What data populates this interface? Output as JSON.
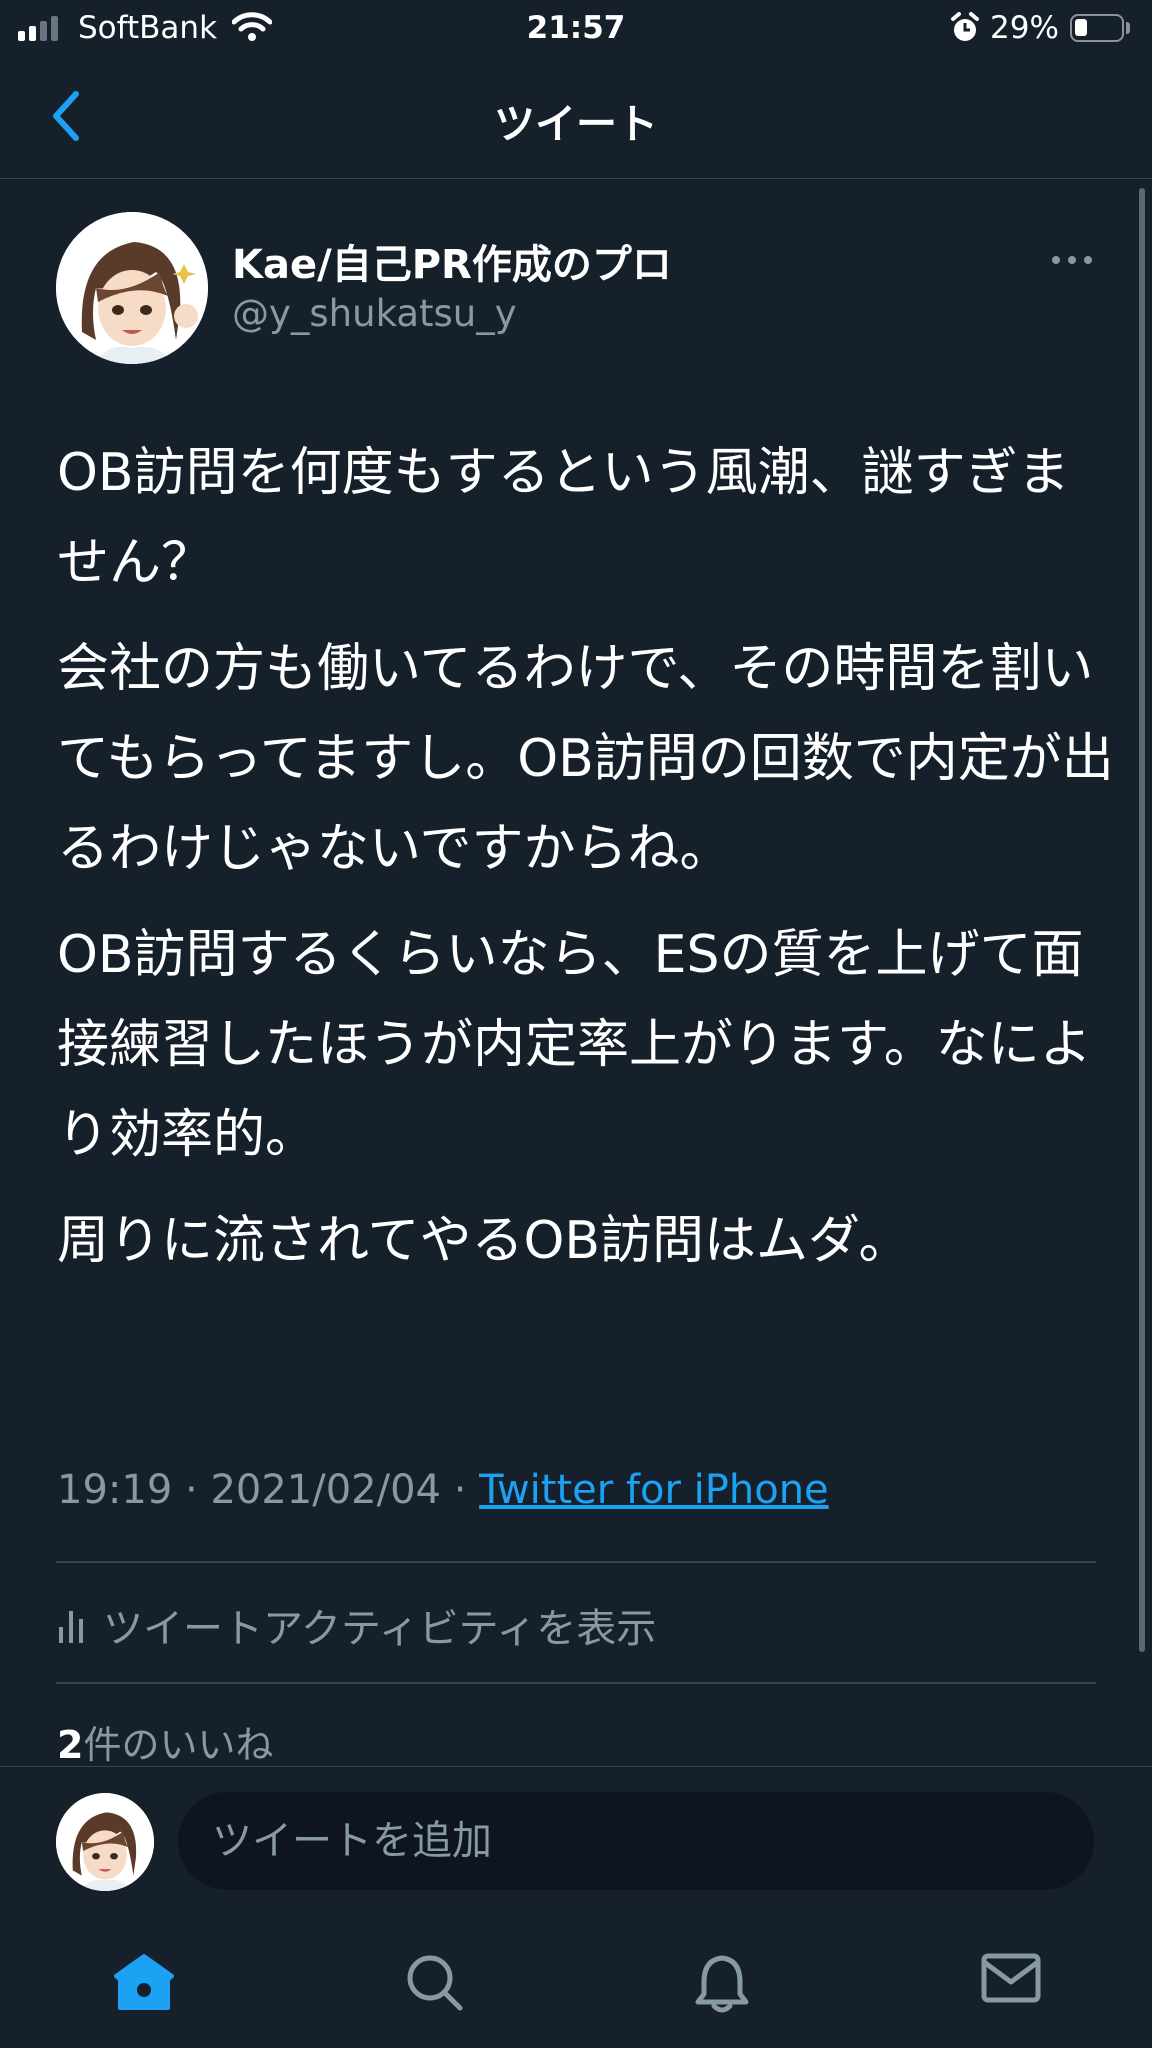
{
  "status_bar": {
    "carrier": "SoftBank",
    "time": "21:57",
    "battery": "29%"
  },
  "nav": {
    "title": "ツイート"
  },
  "tweet": {
    "author_name": "Kae/自己PR作成のプロ",
    "author_handle": "@y_shukatsu_y",
    "paragraphs": [
      "OB訪問を何度もするという風潮、謎すぎません？",
      "会社の方も働いてるわけで、その時間を割いてもらってますし。OB訪問の回数で内定が出るわけじゃないですからね。",
      "OB訪問するくらいなら、ESの質を上げて面接練習したほうが内定率上がります。なにより効率的。",
      "周りに流されてやるOB訪問はムダ。"
    ],
    "time": "19:19",
    "date": "2021/02/04",
    "separator": " · ",
    "source": "Twitter for iPhone",
    "activity_label": "ツイートアクティビティを表示",
    "likes_count": "2",
    "likes_suffix": "件のいいね"
  },
  "reply": {
    "placeholder": "ツイートを追加"
  },
  "tabbar": {
    "items": [
      "home-icon",
      "search-icon",
      "notifications-bell-icon",
      "messages-envelope-icon"
    ],
    "active": "home-icon"
  },
  "colors": {
    "background": "#15202b",
    "accent": "#1da1f2",
    "muted": "#8899a6",
    "divider": "#38444d"
  }
}
